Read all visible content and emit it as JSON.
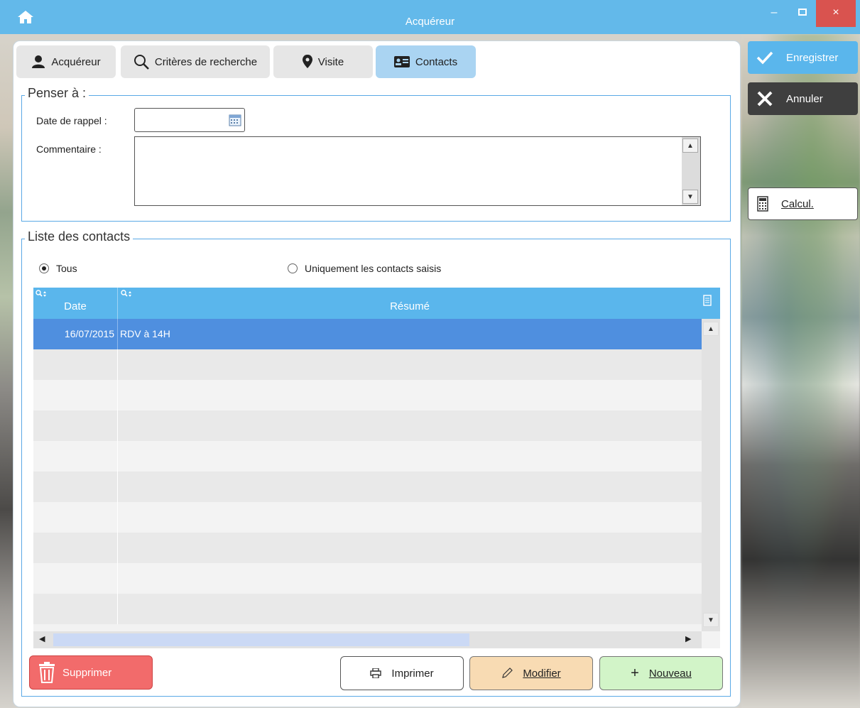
{
  "window": {
    "title": "Acquéreur",
    "minimize": "–",
    "close": "×"
  },
  "tabs": [
    {
      "label": "Acquéreur",
      "icon": "user-icon"
    },
    {
      "label": "Critères de recherche",
      "icon": "search-icon"
    },
    {
      "label": "Visite",
      "icon": "map-pin-icon"
    },
    {
      "label": "Contacts",
      "icon": "contact-card-icon",
      "active": true
    }
  ],
  "reminder": {
    "legend": "Penser à :",
    "date_label": "Date de rappel :",
    "date_value": "",
    "comment_label": "Commentaire :",
    "comment_value": ""
  },
  "contacts": {
    "legend": "Liste des contacts",
    "filter_all": "Tous",
    "filter_entered": "Uniquement les contacts saisis",
    "selected_filter": "Tous",
    "columns": [
      "Date",
      "Résumé"
    ],
    "rows": [
      {
        "date": "16/07/2015",
        "summary": "RDV à 14H"
      }
    ]
  },
  "actions": {
    "delete": "Supprimer",
    "print": "Imprimer",
    "modify": "Modifier",
    "new": "Nouveau"
  },
  "side": {
    "save": "Enregistrer",
    "cancel": "Annuler",
    "calc": "Calcul."
  },
  "colors": {
    "accent": "#5ab6ec",
    "selected_row": "#4f8fdf",
    "delete": "#f26b6b",
    "modify": "#f8dbb3",
    "new": "#d2f4c8"
  }
}
